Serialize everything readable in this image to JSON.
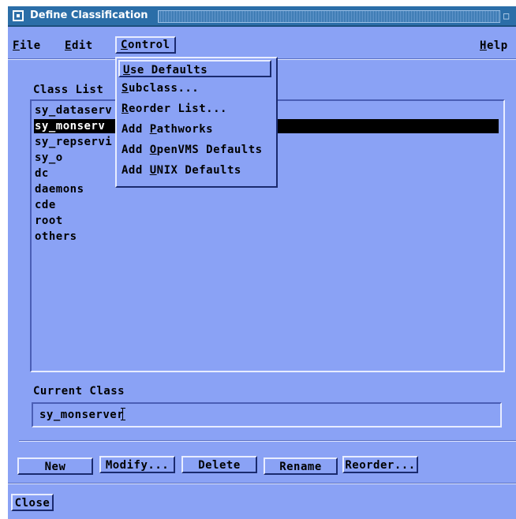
{
  "window": {
    "title": "Define Classification"
  },
  "menubar": {
    "file": {
      "label": "File",
      "mnemonic": "F",
      "rest": "ile"
    },
    "edit": {
      "label": "Edit",
      "mnemonic": "E",
      "rest": "dit"
    },
    "control": {
      "label": "Control",
      "mnemonic": "C",
      "rest": "ontrol"
    },
    "help": {
      "label": "Help",
      "mnemonic": "H",
      "rest": "elp"
    }
  },
  "control_menu": {
    "items": [
      {
        "pre": "",
        "mnemonic": "U",
        "rest": "se Defaults"
      },
      {
        "pre": "",
        "mnemonic": "S",
        "rest": "ubclass..."
      },
      {
        "pre": "",
        "mnemonic": "R",
        "rest": "eorder List..."
      },
      {
        "pre": "Add ",
        "mnemonic": "P",
        "rest": "athworks"
      },
      {
        "pre": "Add ",
        "mnemonic": "O",
        "rest": "penVMS Defaults"
      },
      {
        "pre": "Add ",
        "mnemonic": "U",
        "rest": "NIX Defaults"
      }
    ]
  },
  "class_list": {
    "label": "Class List",
    "items": [
      "sy_dataserv",
      "sy_monserv",
      "sy_repservi",
      "sy_o",
      "dc",
      "daemons",
      "cde",
      "root",
      "others"
    ],
    "selected_index": 1
  },
  "current_class": {
    "label": "Current Class",
    "value": "sy_monserver"
  },
  "buttons": {
    "new": "New",
    "modify": "Modify...",
    "delete": "Delete",
    "rename": "Rename",
    "reorder": "Reorder...",
    "close": "Close"
  },
  "icons": {
    "window_menu": "window-menu-icon",
    "maximize": "maximize-icon"
  }
}
